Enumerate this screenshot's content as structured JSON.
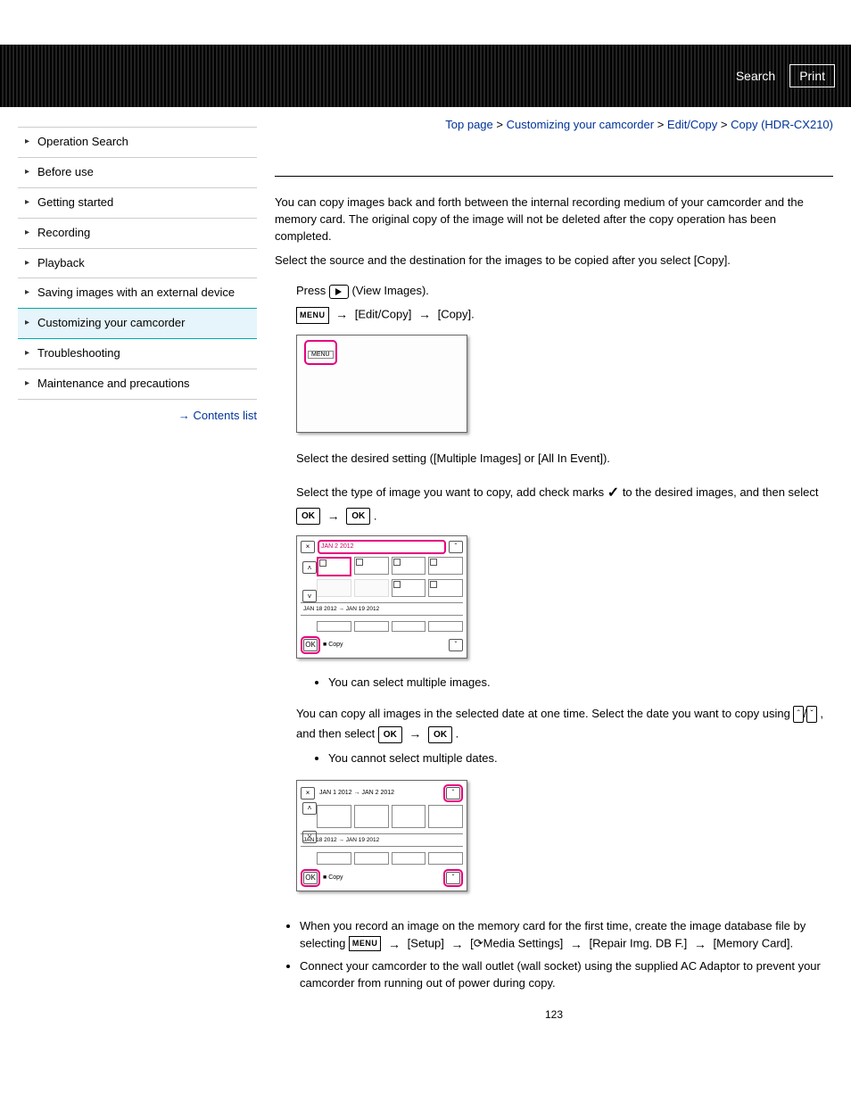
{
  "header": {
    "search": "Search",
    "print": "Print"
  },
  "breadcrumb": {
    "top": "Top page",
    "l1": "Customizing your camcorder",
    "l2": "Edit/Copy",
    "l3": "Copy (HDR-CX210)"
  },
  "sidebar": {
    "items": [
      "Operation Search",
      "Before use",
      "Getting started",
      "Recording",
      "Playback",
      "Saving images with an external device",
      "Customizing your camcorder",
      "Troubleshooting",
      "Maintenance and precautions"
    ],
    "active_index": 6,
    "contents_list": "Contents list"
  },
  "content": {
    "intro1": "You can copy images back and forth between the internal recording medium of your camcorder and the memory card. The original copy of the image will not be deleted after the copy operation has been completed.",
    "intro2": "Select the source and the destination for the images to be copied after you select [Copy].",
    "step1_a": "Press ",
    "step1_b": " (View Images).",
    "menu_label": "MENU",
    "arrow": "→",
    "step1_seq_a": " [Edit/Copy] ",
    "step1_seq_b": " [Copy].",
    "step2": "Select the desired setting ([Multiple Images] or [All In Event]).",
    "step3_a": "Select the type of image you want to copy, add check marks ",
    "check": "✓",
    "step3_b": " to the desired images, and then select ",
    "ok_label": "OK",
    "step3_c": ".",
    "bullet1": "You can select multiple images.",
    "step4_a": "You can copy all images in the selected date at one time. Select the date you want to copy using ",
    "updown_a": "ˆ",
    "updown_b": "ˇ",
    "step4_b": ", and then select ",
    "step4_c": ".",
    "bullet2": "You cannot select multiple dates.",
    "note1_a": "When you record an image on the memory card for the first time, create the image database file by selecting ",
    "note1_seq1": " [Setup] ",
    "note1_seq2": " [",
    "note1_media": "Media Settings] ",
    "note1_seq3": " [Repair Img. DB F.] ",
    "note1_seq4": " [Memory Card].",
    "note2": "Connect your camcorder to the wall outlet (wall socket) using the supplied AC Adaptor to prevent your camcorder from running out of power during copy.",
    "thumb1": {
      "date_top": "JAN 2 2012",
      "date_range": "JAN 18 2012 → JAN 19 2012",
      "copy": "Copy"
    },
    "thumb2": {
      "date_top": "JAN 1 2012 → JAN 2 2012",
      "date_range": "JAN 18 2012 → JAN 19 2012",
      "copy": "Copy"
    }
  },
  "page_number": "123"
}
